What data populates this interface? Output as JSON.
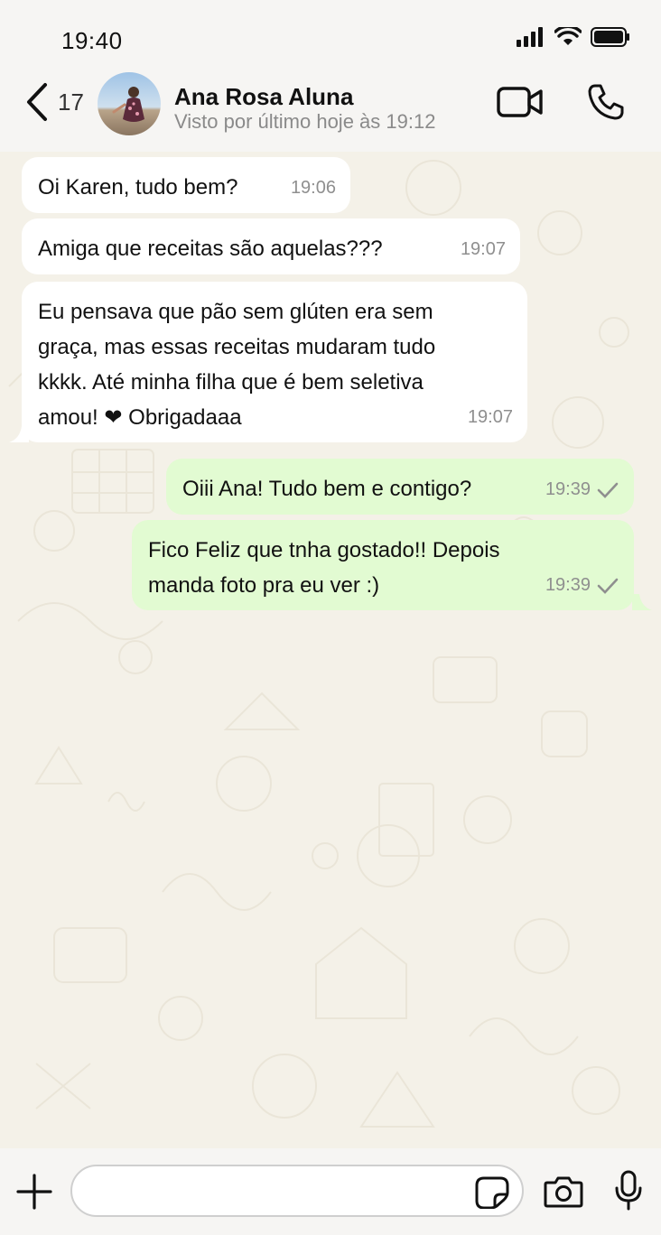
{
  "status_bar": {
    "time": "19:40",
    "signal_icon": "signal-bars-icon",
    "wifi_icon": "wifi-icon",
    "battery_icon": "battery-icon"
  },
  "header": {
    "back_count": "17",
    "contact_name": "Ana Rosa Aluna",
    "contact_status": "Visto por último hoje às 19:12"
  },
  "messages": [
    {
      "direction": "in",
      "text": "Oi Karen, tudo bem?",
      "time": "19:06"
    },
    {
      "direction": "in",
      "text": "Amiga que receitas são aquelas???",
      "time": "19:07"
    },
    {
      "direction": "in",
      "text": "Eu pensava que pão sem glúten era sem\ngraça, mas essas receitas mudaram tudo\nkkkk. Até minha filha que é bem seletiva\namou! ❤ Obrigadaaa",
      "time": "19:07"
    },
    {
      "direction": "out",
      "text": "Oiii Ana! Tudo bem e contigo?",
      "time": "19:39",
      "status": "sent"
    },
    {
      "direction": "out",
      "text": "Fico Feliz que tnha gostado!! Depois\nmanda foto pra eu ver :)",
      "time": "19:39",
      "status": "sent"
    }
  ],
  "composer": {
    "placeholder": ""
  },
  "colors": {
    "incoming_bubble": "#ffffff",
    "outgoing_bubble": "#e2fbd2",
    "chat_background": "#f4f1e8"
  }
}
